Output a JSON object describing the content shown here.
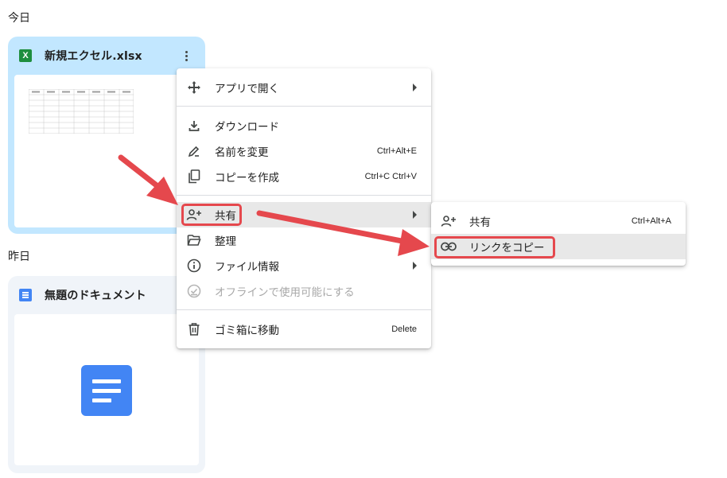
{
  "sections": {
    "today": "今日",
    "yesterday": "昨日"
  },
  "files": [
    {
      "name": "新規エクセル.xlsx",
      "icon": "excel-icon",
      "icon_letter": "X"
    },
    {
      "name": "無題のドキュメント",
      "icon": "docs-icon"
    }
  ],
  "context_menu": {
    "open_with": "アプリで開く",
    "download": "ダウンロード",
    "rename": "名前を変更",
    "rename_shortcut": "Ctrl+Alt+E",
    "make_copy": "コピーを作成",
    "make_copy_shortcut": "Ctrl+C Ctrl+V",
    "share": "共有",
    "organize": "整理",
    "file_info": "ファイル情報",
    "offline": "オフラインで使用可能にする",
    "trash": "ゴミ箱に移動",
    "trash_shortcut": "Delete"
  },
  "share_submenu": {
    "share": "共有",
    "share_shortcut": "Ctrl+Alt+A",
    "copy_link": "リンクをコピー"
  },
  "colors": {
    "annotation": "#e5484d",
    "selected_card": "#c2e7ff",
    "excel_green": "#1e8e3e",
    "docs_blue": "#4285f4"
  }
}
